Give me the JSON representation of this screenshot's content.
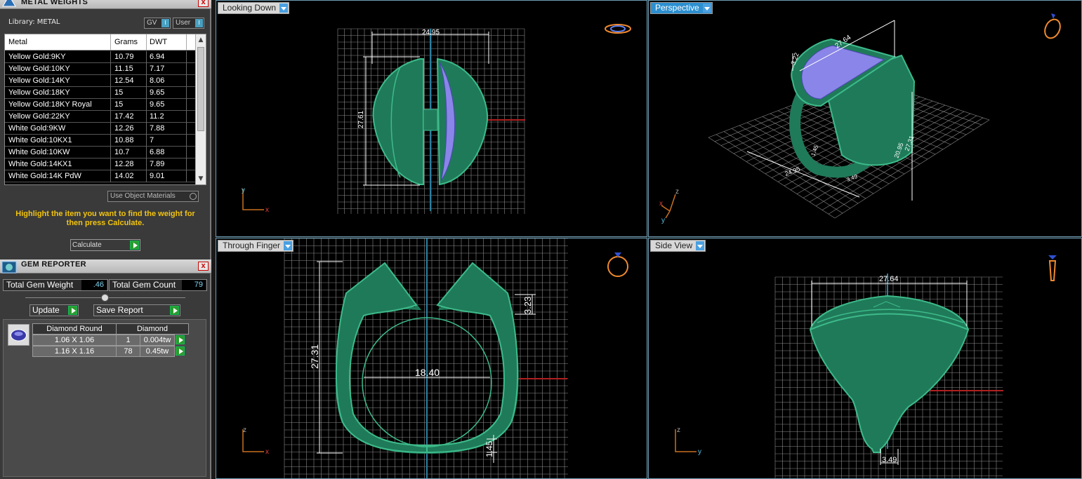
{
  "metal_panel": {
    "title": "METAL WEIGHTS",
    "library_label": "Library: METAL",
    "toggle_gv": "GV",
    "toggle_user": "User",
    "columns": [
      "Metal",
      "Grams",
      "DWT"
    ],
    "rows": [
      [
        "Yellow Gold:9KY",
        "10.79",
        "6.94"
      ],
      [
        "Yellow Gold:10KY",
        "11.15",
        "7.17"
      ],
      [
        "Yellow Gold:14KY",
        "12.54",
        "8.06"
      ],
      [
        "Yellow Gold:18KY",
        "15",
        "9.65"
      ],
      [
        "Yellow Gold:18KY Royal",
        "15",
        "9.65"
      ],
      [
        "Yellow Gold:22KY",
        "17.42",
        "11.2"
      ],
      [
        "White Gold:9KW",
        "12.26",
        "7.88"
      ],
      [
        "White Gold:10KX1",
        "10.88",
        "7"
      ],
      [
        "White Gold:10KW",
        "10.7",
        "6.88"
      ],
      [
        "White Gold:14KX1",
        "12.28",
        "7.89"
      ],
      [
        "White Gold:14K PdW",
        "14.02",
        "9.01"
      ]
    ],
    "use_object_materials": "Use Object Materials",
    "hint": "Highlight the item you want to find the weight for then press Calculate.",
    "calculate": "Calculate",
    "close": "x"
  },
  "gem_panel": {
    "title": "GEM REPORTER",
    "total_weight_label": "Total Gem Weight",
    "total_weight": ".46",
    "total_count_label": "Total Gem Count",
    "total_count": "79",
    "update": "Update",
    "save_report": "Save Report",
    "headers": [
      "Diamond Round",
      "Diamond"
    ],
    "rows": [
      [
        "1.06 X 1.06",
        "1",
        "0.004tw"
      ],
      [
        "1.16 X 1.16",
        "78",
        "0.45tw"
      ]
    ],
    "close": "x"
  },
  "viewports": {
    "looking_down": {
      "label": "Looking Down",
      "dim_width": "24.95",
      "dim_height": "27.61",
      "axis_v": "y",
      "axis_h": "x"
    },
    "perspective": {
      "label": "Perspective",
      "dim_a": "27.64",
      "dim_b": "3.22",
      "dim_c": "20.95",
      "dim_d": "27.31",
      "dim_e": "24.95",
      "dim_f": "3.49",
      "dim_g": "1.45",
      "axis_z": "z",
      "axis_x": "x",
      "axis_y": "y"
    },
    "through_finger": {
      "label": "Through Finger",
      "dim_height": "27.31",
      "dim_inner": "18.40",
      "dim_top": "3.23",
      "dim_bottom": "1.45",
      "axis_v": "z",
      "axis_h": "x"
    },
    "side_view": {
      "label": "Side View",
      "dim_width": "27.64",
      "dim_bottom": "3.49",
      "axis_v": "z",
      "axis_h": "y"
    }
  },
  "colors": {
    "ring_green": "#1f7a5a",
    "ring_edge": "#3dbb8a",
    "pave_blue": "#8a85e8",
    "grid": "#8a8a8a",
    "viewport_border": "#6d9fb6"
  }
}
